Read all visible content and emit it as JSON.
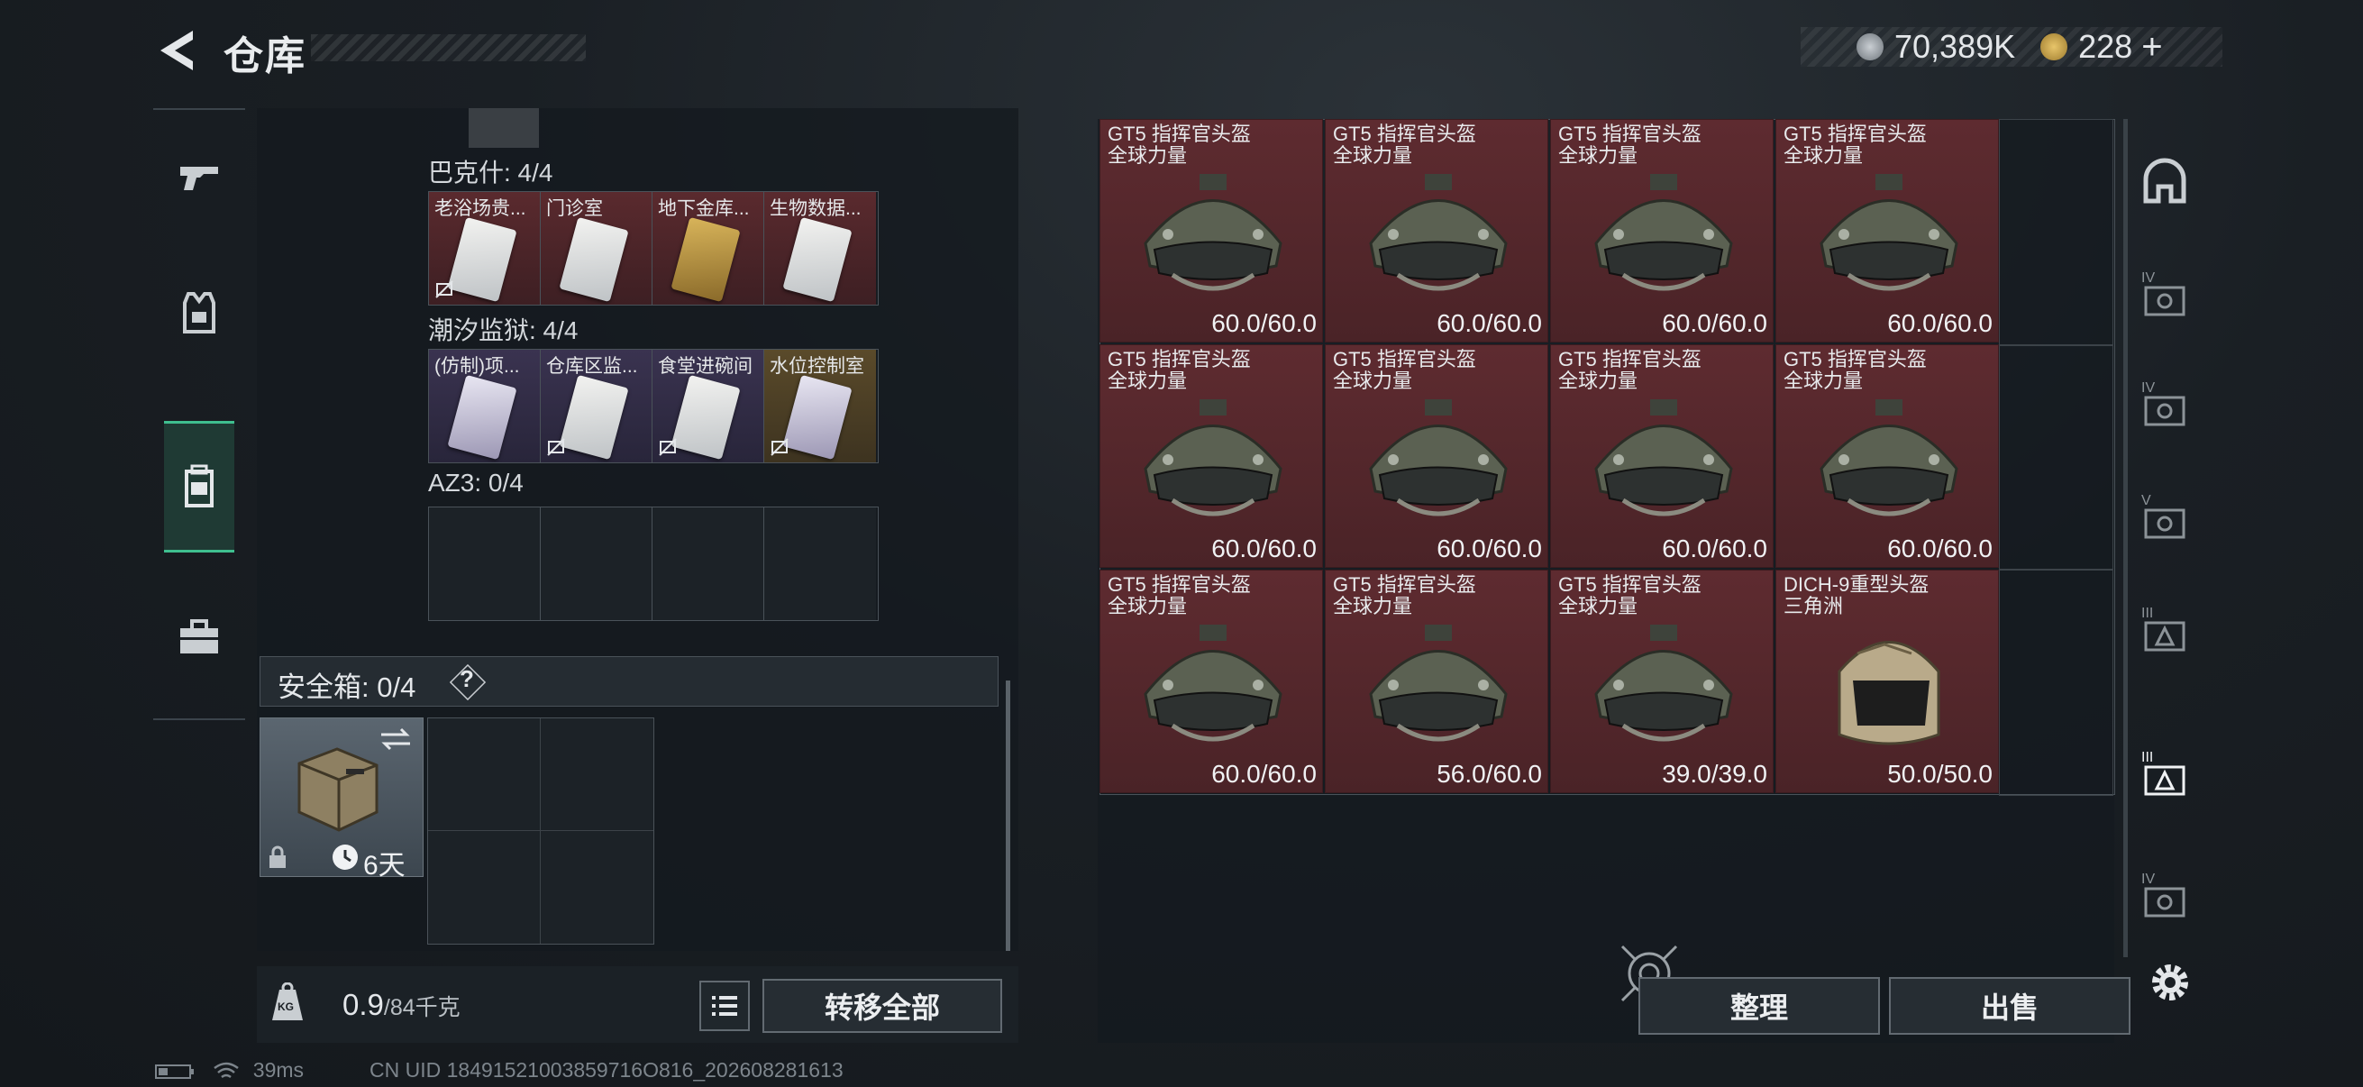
{
  "header": {
    "title": "仓库",
    "currency_1": "70,389K",
    "currency_2": "228",
    "currency_2_plus": "+"
  },
  "left_panel": {
    "groups": [
      {
        "label": "巴克什: 4/4",
        "slots": [
          {
            "name": "老浴场贵...",
            "tint": "red",
            "card": "white",
            "no_icon": true
          },
          {
            "name": "门诊室",
            "tint": "red",
            "card": "white",
            "no_icon": false
          },
          {
            "name": "地下金库...",
            "tint": "red",
            "card": "gold",
            "no_icon": false
          },
          {
            "name": "生物数据...",
            "tint": "red",
            "card": "white",
            "no_icon": false
          }
        ]
      },
      {
        "label": "潮汐监狱: 4/4",
        "slots": [
          {
            "name": "(仿制)项...",
            "tint": "purple",
            "card": "purple",
            "no_icon": false
          },
          {
            "name": "仓库区监...",
            "tint": "purple",
            "card": "white",
            "no_icon": true
          },
          {
            "name": "食堂进碗间",
            "tint": "purple",
            "card": "white",
            "no_icon": true
          },
          {
            "name": "水位控制室",
            "tint": "gold",
            "card": "purple",
            "no_icon": true
          }
        ]
      },
      {
        "label": "AZ3: 0/4",
        "slots": []
      }
    ],
    "safebox": {
      "label": "安全箱:  0/4",
      "help": "?",
      "timer": "6天",
      "kg_badge": "KG"
    },
    "weight": {
      "current": "0.9",
      "max": "/84千克",
      "icon_label": "KG"
    },
    "transfer_all": "转移全部"
  },
  "inventory": {
    "items": [
      {
        "name": "GT5 指挥官头盔",
        "sub": "全球力量",
        "durability": "60.0/60.0",
        "type": "gt5"
      },
      {
        "name": "GT5 指挥官头盔",
        "sub": "全球力量",
        "durability": "60.0/60.0",
        "type": "gt5"
      },
      {
        "name": "GT5 指挥官头盔",
        "sub": "全球力量",
        "durability": "60.0/60.0",
        "type": "gt5"
      },
      {
        "name": "GT5 指挥官头盔",
        "sub": "全球力量",
        "durability": "60.0/60.0",
        "type": "gt5"
      },
      {
        "name": "GT5 指挥官头盔",
        "sub": "全球力量",
        "durability": "60.0/60.0",
        "type": "gt5"
      },
      {
        "name": "GT5 指挥官头盔",
        "sub": "全球力量",
        "durability": "60.0/60.0",
        "type": "gt5"
      },
      {
        "name": "GT5 指挥官头盔",
        "sub": "全球力量",
        "durability": "60.0/60.0",
        "type": "gt5"
      },
      {
        "name": "GT5 指挥官头盔",
        "sub": "全球力量",
        "durability": "60.0/60.0",
        "type": "gt5"
      },
      {
        "name": "GT5 指挥官头盔",
        "sub": "全球力量",
        "durability": "60.0/60.0",
        "type": "gt5"
      },
      {
        "name": "GT5 指挥官头盔",
        "sub": "全球力量",
        "durability": "56.0/60.0",
        "type": "gt5"
      },
      {
        "name": "GT5 指挥官头盔",
        "sub": "全球力量",
        "durability": "39.0/39.0",
        "type": "gt5"
      },
      {
        "name": "DICH-9重型头盔",
        "sub": "三角洲",
        "durability": "50.0/50.0",
        "type": "dich"
      }
    ],
    "sort_label": "整理",
    "sell_label": "出售"
  },
  "right_nav": {
    "badges": [
      "IV",
      "IV",
      "V",
      "III",
      "III",
      "IV"
    ]
  },
  "status_bar": {
    "ping": "39ms",
    "uid": "CN UID 18491521003859716O816_202608281613"
  },
  "colors": {
    "accent_green": "#3fbf8f",
    "red_slot": "#5e2b30"
  }
}
